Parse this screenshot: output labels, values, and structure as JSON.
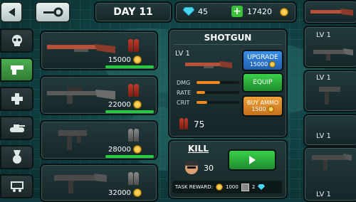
{
  "header": {
    "day": "DAY 11",
    "gems": "45",
    "coins": "17420"
  },
  "weapon_list": [
    {
      "price": "15000",
      "type": "shotgun"
    },
    {
      "price": "22000",
      "type": "rifle"
    },
    {
      "price": "28000",
      "type": "smg"
    },
    {
      "price": "32000",
      "type": "assault"
    }
  ],
  "detail": {
    "title": "SHOTGUN",
    "level": "LV 1",
    "stats": [
      {
        "label": "DMG",
        "value": 0.55
      },
      {
        "label": "RATE",
        "value": 0.2
      },
      {
        "label": "CRIT",
        "value": 0.25
      }
    ],
    "upgrade_label": "UPGRADE",
    "upgrade_price": "15000",
    "equip_label": "EQUIP",
    "buy_ammo_label": "BUY AMMO",
    "buy_ammo_price": "1500",
    "ammo_count": "75"
  },
  "kill": {
    "title": "KILL",
    "count": "30",
    "task_label": "TASK REWARD:",
    "reward_coins": "1000",
    "reward_gems": "2"
  },
  "right_column": [
    {
      "level": "LV 1"
    },
    {
      "level": "LV 1"
    },
    {
      "level": "LV 1"
    },
    {
      "level": "LV 1"
    }
  ],
  "colors": {
    "accent_green": "#28c840",
    "orange": "#f08a1c",
    "blue_button": "#2f7fd6"
  }
}
